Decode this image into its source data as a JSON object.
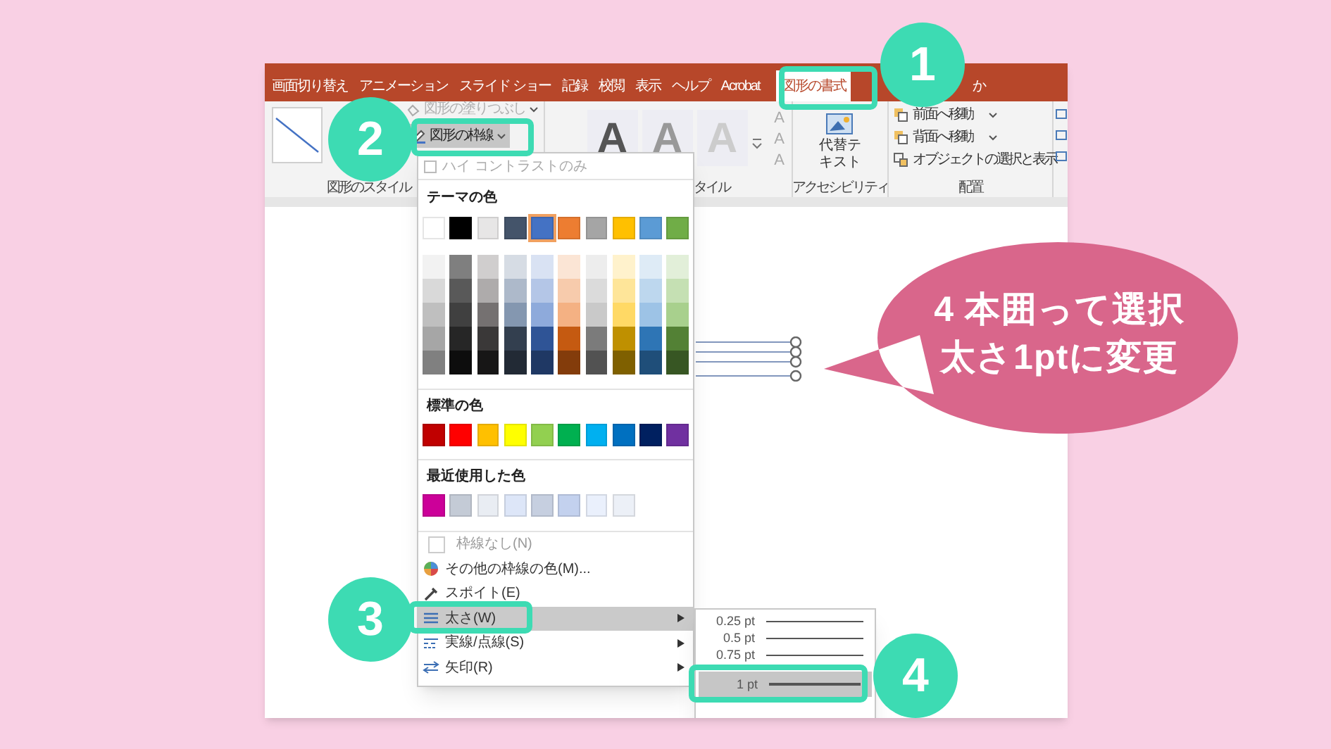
{
  "tabs": [
    {
      "label": "画面切り替え",
      "selected": false
    },
    {
      "label": "アニメーション",
      "selected": false
    },
    {
      "label": "スライド ショー",
      "selected": false
    },
    {
      "label": "記録",
      "selected": false
    },
    {
      "label": "校閲",
      "selected": false
    },
    {
      "label": "表示",
      "selected": false
    },
    {
      "label": "ヘルプ",
      "selected": false
    },
    {
      "label": "Acrobat",
      "selected": false
    },
    {
      "label": "図形の書式",
      "selected": true
    }
  ],
  "tell_me": "か",
  "ribbon": {
    "shape_fill": {
      "label": "図形の塗りつぶし",
      "disabled": true
    },
    "shape_outline": {
      "label": "図形の枠線"
    },
    "shape_styles_label": "図形のスタイル",
    "wordart_samples": [
      "A",
      "A",
      "A"
    ],
    "text_effect_buttons": [
      "A",
      "A",
      "A"
    ],
    "wordart_label": "タイル",
    "alt_text": "代替テキスト",
    "accessibility_label": "アクセシビリティ",
    "arrange_items": [
      {
        "label": "前面へ移動",
        "dropdown": true
      },
      {
        "label": "背面へ移動",
        "dropdown": true
      },
      {
        "label": "オブジェクトの選択と表示",
        "dropdown": false
      }
    ],
    "arrange_label": "配置"
  },
  "outline_menu": {
    "high_contrast": {
      "label": "ハイ コントラストのみ",
      "checked": false
    },
    "theme_heading": "テーマの色",
    "theme_colors": [
      {
        "color": "#ffffff",
        "selected": false,
        "shades": [
          {
            "color": "#f2f2f2"
          },
          {
            "color": "#d9d9d9"
          },
          {
            "color": "#bfbfbf"
          },
          {
            "color": "#a6a6a6"
          },
          {
            "color": "#808080"
          }
        ]
      },
      {
        "color": "#000000",
        "selected": false,
        "shades": [
          {
            "color": "#7f7f7f"
          },
          {
            "color": "#595959"
          },
          {
            "color": "#404040"
          },
          {
            "color": "#262626"
          },
          {
            "color": "#0d0d0d"
          }
        ]
      },
      {
        "color": "#e7e6e6",
        "selected": false,
        "shades": [
          {
            "color": "#d0cece"
          },
          {
            "color": "#aeabab"
          },
          {
            "color": "#757171"
          },
          {
            "color": "#3a3838"
          },
          {
            "color": "#171616"
          }
        ]
      },
      {
        "color": "#44546a",
        "selected": false,
        "shades": [
          {
            "color": "#d6dce4"
          },
          {
            "color": "#adb9ca"
          },
          {
            "color": "#8497b0"
          },
          {
            "color": "#333f4f"
          },
          {
            "color": "#222a35"
          }
        ]
      },
      {
        "color": "#4472c4",
        "selected": true,
        "shades": [
          {
            "color": "#d9e2f3"
          },
          {
            "color": "#b4c6e7"
          },
          {
            "color": "#8eaadb"
          },
          {
            "color": "#2f5496"
          },
          {
            "color": "#1f3864"
          }
        ]
      },
      {
        "color": "#ed7d31",
        "selected": false,
        "shades": [
          {
            "color": "#fbe5d5"
          },
          {
            "color": "#f7cbac"
          },
          {
            "color": "#f4b183"
          },
          {
            "color": "#c55a11"
          },
          {
            "color": "#833c0b"
          }
        ]
      },
      {
        "color": "#a5a5a5",
        "selected": false,
        "shades": [
          {
            "color": "#ededed"
          },
          {
            "color": "#dbdbdb"
          },
          {
            "color": "#c9c9c9"
          },
          {
            "color": "#7b7b7b"
          },
          {
            "color": "#525252"
          }
        ]
      },
      {
        "color": "#ffc000",
        "selected": false,
        "shades": [
          {
            "color": "#fff2cc"
          },
          {
            "color": "#fee599"
          },
          {
            "color": "#ffd965"
          },
          {
            "color": "#bf9000"
          },
          {
            "color": "#7f6000"
          }
        ]
      },
      {
        "color": "#5b9bd5",
        "selected": false,
        "shades": [
          {
            "color": "#deebf6"
          },
          {
            "color": "#bdd7ee"
          },
          {
            "color": "#9dc3e6"
          },
          {
            "color": "#2e75b5"
          },
          {
            "color": "#1f4e79"
          }
        ]
      },
      {
        "color": "#70ad47",
        "selected": false,
        "shades": [
          {
            "color": "#e2efd9"
          },
          {
            "color": "#c5e0b3"
          },
          {
            "color": "#a8d08d"
          },
          {
            "color": "#538135"
          },
          {
            "color": "#375623"
          }
        ]
      }
    ],
    "standard_heading": "標準の色",
    "standard_colors": [
      {
        "color": "#c00000"
      },
      {
        "color": "#ff0000"
      },
      {
        "color": "#ffc000"
      },
      {
        "color": "#ffff00"
      },
      {
        "color": "#92d050"
      },
      {
        "color": "#00b050"
      },
      {
        "color": "#00b0f0"
      },
      {
        "color": "#0070c0"
      },
      {
        "color": "#002060"
      },
      {
        "color": "#7030a0"
      }
    ],
    "recent_heading": "最近使用した色",
    "recent_colors": [
      {
        "color": "#cc0099"
      },
      {
        "color": "#c4cbd6"
      },
      {
        "color": "#e9edf3"
      },
      {
        "color": "#dde6f8"
      },
      {
        "color": "#c6cfe0"
      },
      {
        "color": "#c3d1ee"
      },
      {
        "color": "#eaf0fc"
      },
      {
        "color": "#ecf0f7"
      }
    ],
    "items": [
      {
        "kind": "no-outline",
        "label": "枠線なし(N)",
        "selected": false,
        "submenu": false
      },
      {
        "kind": "palette",
        "label": "その他の枠線の色(M)...",
        "selected": false,
        "submenu": false
      },
      {
        "kind": "eyedropper",
        "label": "スポイト(E)",
        "selected": false,
        "submenu": false
      },
      {
        "kind": "weight",
        "label": "太さ(W)",
        "selected": true,
        "submenu": true
      },
      {
        "kind": "dashes",
        "label": "実線/点線(S)",
        "selected": false,
        "submenu": true
      },
      {
        "kind": "arrows",
        "label": "矢印(R)",
        "selected": false,
        "submenu": true
      }
    ]
  },
  "weight_menu": [
    {
      "label": "0.25 pt",
      "selected": false
    },
    {
      "label": "0.5 pt",
      "selected": false
    },
    {
      "label": "0.75 pt",
      "selected": false
    },
    {
      "label": "1 pt",
      "selected": true
    }
  ],
  "callout": [
    "4 本囲って選択",
    "太さ1ptに変更"
  ],
  "steps": [
    "1",
    "2",
    "3",
    "4"
  ]
}
